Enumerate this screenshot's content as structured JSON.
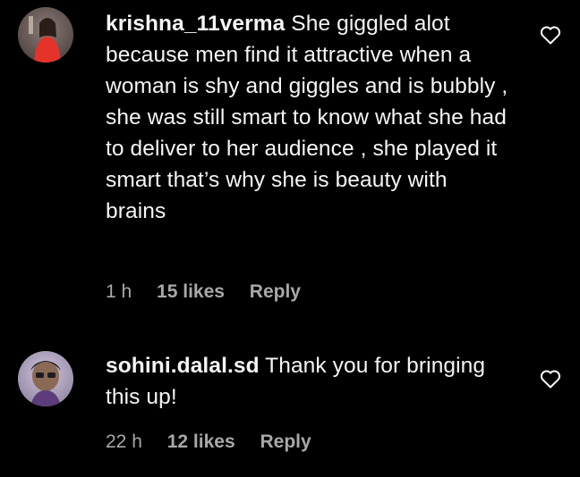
{
  "comments": [
    {
      "username": "krishna_11verma",
      "text": "She giggled alot because men find it attractive when a woman is shy and giggles and is bubbly , she was still smart to know what she had to deliver to her audience , she played it smart that’s why she is beauty with brains",
      "time": "1 h",
      "likes": "15 likes",
      "reply_label": "Reply",
      "avatar_icon": "user-avatar-photo"
    },
    {
      "username": "sohini.dalal.sd",
      "text": "Thank you for bringing this up!",
      "time": "22 h",
      "likes": "12 likes",
      "reply_label": "Reply",
      "avatar_icon": "user-avatar-photo"
    }
  ],
  "colors": {
    "background": "#000000",
    "text": "#f5f5f5",
    "meta": "#a8a8a8"
  },
  "icons": {
    "like": "heart-outline-icon"
  }
}
